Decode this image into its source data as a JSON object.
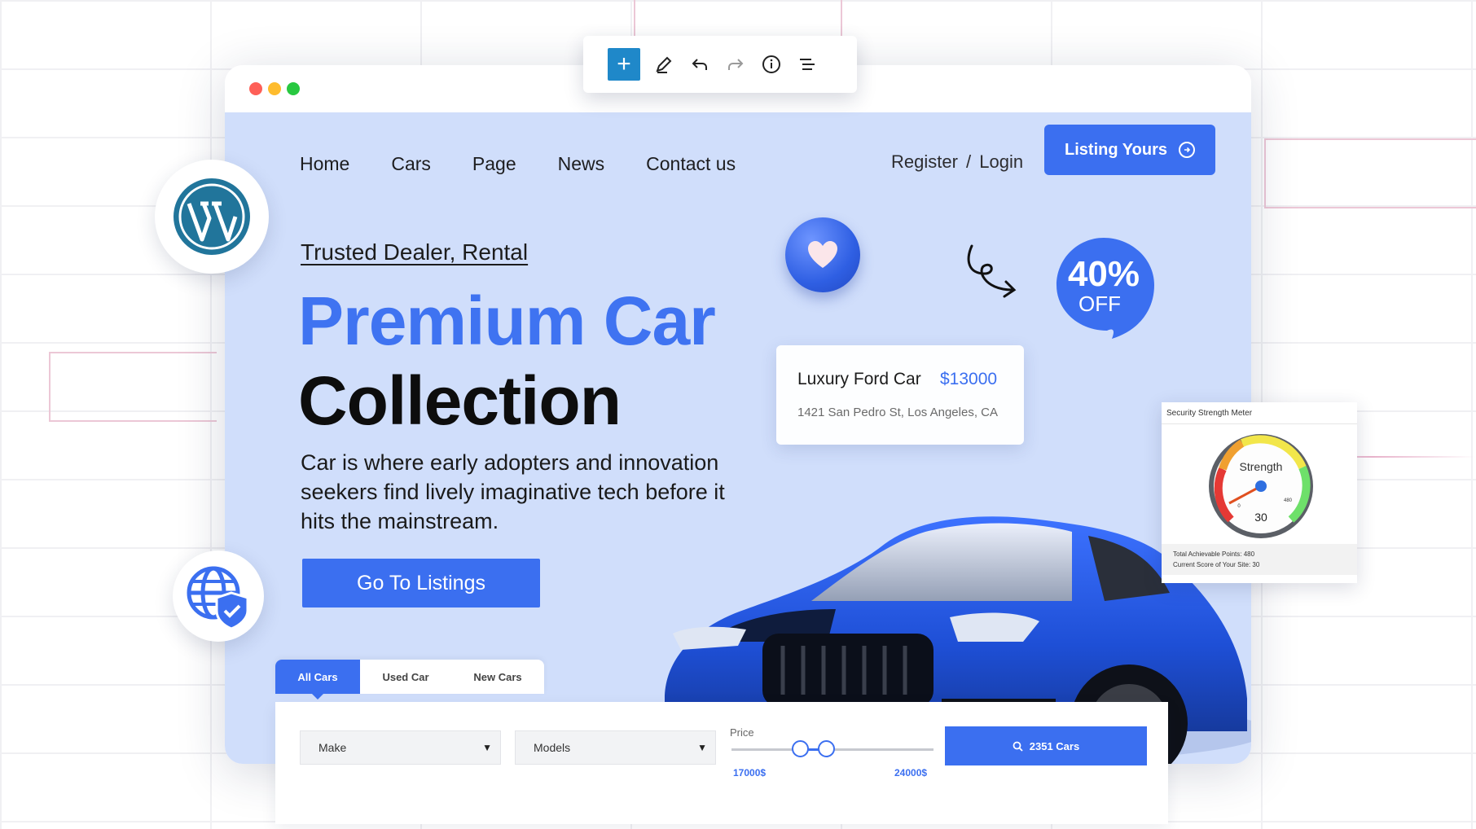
{
  "toolbar": {
    "add_label": "+"
  },
  "nav": {
    "items": [
      {
        "label": "Home"
      },
      {
        "label": "Cars"
      },
      {
        "label": "Page"
      },
      {
        "label": "News"
      },
      {
        "label": "Contact us"
      }
    ],
    "register_label": "Register",
    "auth_separator": "/",
    "login_label": "Login",
    "listing_button": "Listing Yours"
  },
  "hero": {
    "tagline": "Trusted Dealer, Rental",
    "title_line1": "Premium Car",
    "title_line2": "Collection",
    "description": "Car is where early adopters and innovation seekers find lively imaginative tech before it hits the mainstream.",
    "cta": "Go To Listings"
  },
  "badge": {
    "percent": "40%",
    "off": "OFF"
  },
  "listing_card": {
    "name": "Luxury Ford Car",
    "price": "$13000",
    "address": "1421 San Pedro St, Los Angeles, CA"
  },
  "filter": {
    "tabs": [
      {
        "label": "All Cars",
        "active": true
      },
      {
        "label": "Used Car",
        "active": false
      },
      {
        "label": "New Cars",
        "active": false
      }
    ],
    "make_value": "Make",
    "models_value": "Models",
    "price_label": "Price",
    "price_min": "17000$",
    "price_max": "24000$",
    "search_button": "2351 Cars"
  },
  "security_meter": {
    "title": "Security Strength Meter",
    "gauge_label": "Strength",
    "gauge_value": "30",
    "scale_min": "0",
    "scale_max": "480",
    "total_points": "Total Achievable Points: 480",
    "current_score": "Current Score of Your Site: 30"
  },
  "colors": {
    "accent": "#3b6ff0",
    "hero_bg": "#d0defb",
    "toolbar_add": "#1f88c9"
  },
  "icons": [
    "plus-icon",
    "pencil-icon",
    "undo-icon",
    "redo-icon",
    "info-icon",
    "list-icon",
    "wordpress-icon",
    "globe-shield-icon",
    "heart-icon",
    "arrow-circle-right-icon",
    "search-icon",
    "chevron-down-icon"
  ]
}
